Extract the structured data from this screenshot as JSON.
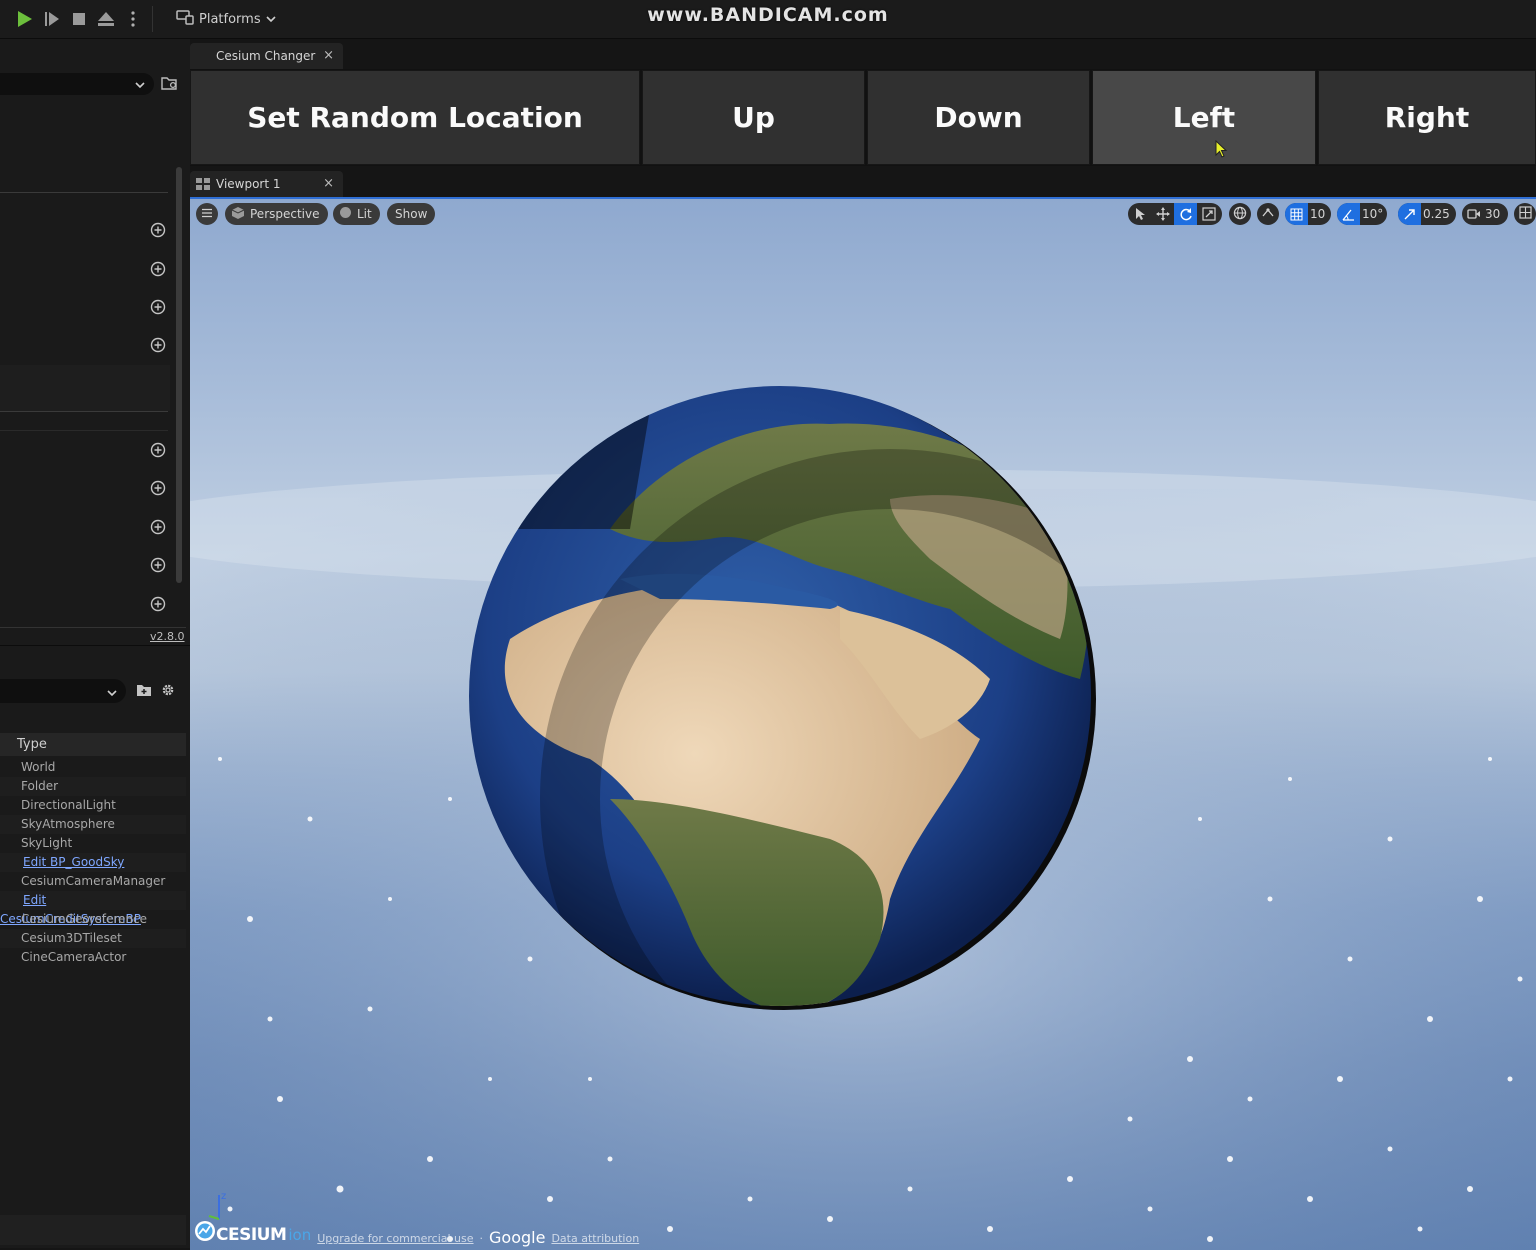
{
  "watermark": "www.BANDICAM.com",
  "toolbar": {
    "platforms_label": "Platforms"
  },
  "tabs": {
    "widget_tab": "Cesium Changer",
    "viewport_tab": "Viewport 1",
    "close_glyph": "×"
  },
  "buttons": {
    "set_random": "Set Random Location",
    "up": "Up",
    "down": "Down",
    "left": "Left",
    "right": "Right"
  },
  "viewport": {
    "perspective": "Perspective",
    "lit": "Lit",
    "show": "Show",
    "grid_snap": "10",
    "rotation_snap": "10°",
    "scale_snap": "0.25",
    "camera_speed": "30"
  },
  "left_panel": {
    "version": "v2.8.0"
  },
  "outliner": {
    "type_header": "Type",
    "rows": [
      {
        "label": "World"
      },
      {
        "label": "Folder"
      },
      {
        "label": "DirectionalLight"
      },
      {
        "label": "SkyAtmosphere"
      },
      {
        "label": "SkyLight"
      },
      {
        "label": "Edit BP_GoodSky"
      },
      {
        "label": "CesiumCameraManager"
      },
      {
        "label": "Edit CesiumCreditSystemBP"
      },
      {
        "label": "CesiumGeoreference"
      },
      {
        "label": "Cesium3DTileset"
      },
      {
        "label": "CineCameraActor"
      }
    ]
  },
  "credits": {
    "cesium": "CESIUM",
    "ion": "ion",
    "upgrade": "Upgrade for commercial use",
    "separator": "·",
    "google": "Google",
    "attribution": "Data attribution"
  },
  "colors": {
    "accent": "#1f6fe0",
    "link": "#7fa7ff",
    "play": "#6cbf3c"
  }
}
